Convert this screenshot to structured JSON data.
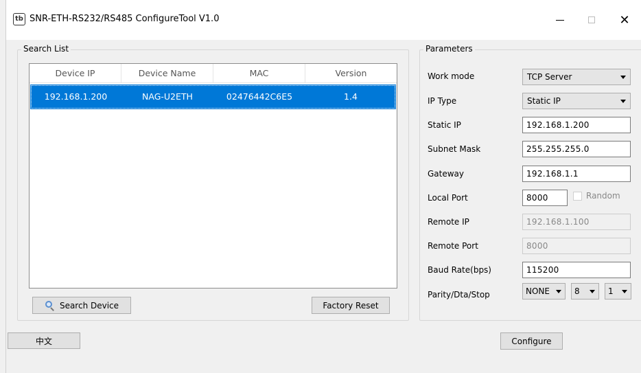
{
  "window": {
    "title": "SNR-ETH-RS232/RS485 ConfigureTool V1.0",
    "icon_glyph": "tb",
    "minimize_glyph": "—",
    "close_glyph": "✕"
  },
  "search_list": {
    "group_label": "Search List",
    "columns": [
      "Device IP",
      "Device Name",
      "MAC",
      "Version"
    ],
    "rows": [
      {
        "ip": "192.168.1.200",
        "name": "NAG-U2ETH",
        "mac": "02476442C6E5",
        "version": "1.4",
        "selected": true
      }
    ],
    "search_button": "Search Device",
    "reset_button": "Factory Reset"
  },
  "parameters": {
    "group_label": "Parameters",
    "work_mode": {
      "label": "Work mode",
      "value": "TCP Server"
    },
    "ip_type": {
      "label": "IP Type",
      "value": "Static IP"
    },
    "static_ip": {
      "label": "Static IP",
      "value": "192.168.1.200"
    },
    "subnet_mask": {
      "label": "Subnet Mask",
      "value": "255.255.255.0"
    },
    "gateway": {
      "label": "Gateway",
      "value": "192.168.1.1"
    },
    "local_port": {
      "label": "Local Port",
      "value": "8000",
      "random_label": "Random",
      "random_checked": false
    },
    "remote_ip": {
      "label": "Remote IP",
      "value": "192.168.1.100",
      "disabled": true
    },
    "remote_port": {
      "label": "Remote Port",
      "value": "8000",
      "disabled": true
    },
    "baud_rate": {
      "label": "Baud Rate(bps)",
      "value": "115200"
    },
    "parity": {
      "label": "Parity/Dta/Stop",
      "parity_value": "NONE",
      "data_value": "8",
      "stop_value": "1"
    }
  },
  "footer": {
    "language_button": "中文",
    "configure_button": "Configure"
  },
  "colors": {
    "selection": "#0078d7",
    "background": "#f0f0f0"
  }
}
